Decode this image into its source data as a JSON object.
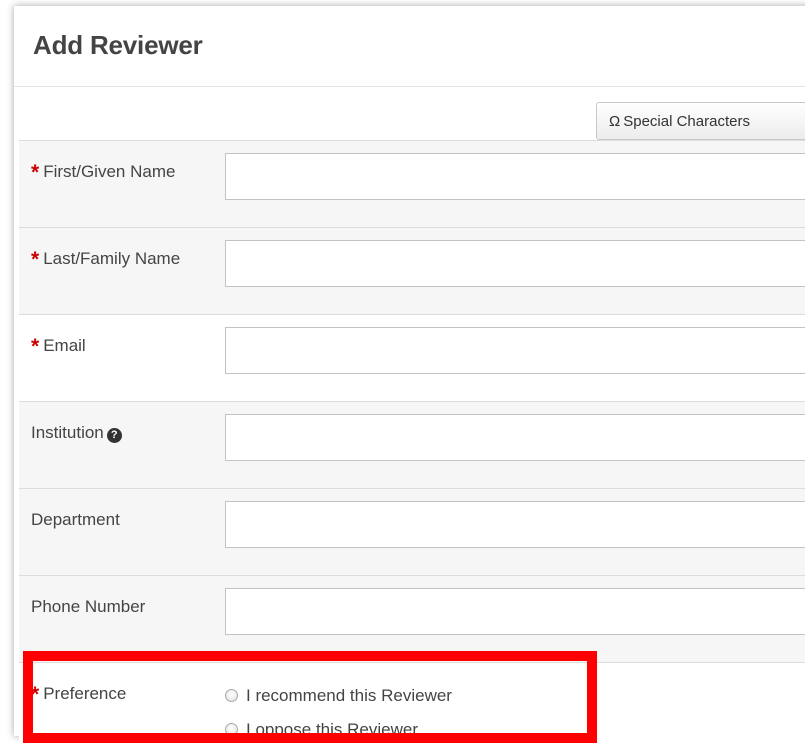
{
  "dialog": {
    "title": "Add Reviewer",
    "special_characters_button": {
      "symbol": "Ω",
      "label": "Special Characters"
    }
  },
  "fields": {
    "first_name": {
      "label": "First/Given Name",
      "required_marker": "*",
      "value": ""
    },
    "last_name": {
      "label": "Last/Family Name",
      "required_marker": "*",
      "value": ""
    },
    "email": {
      "label": "Email",
      "required_marker": "*",
      "value": ""
    },
    "institution": {
      "label": "Institution",
      "help_icon_symbol": "?",
      "value": ""
    },
    "department": {
      "label": "Department",
      "value": ""
    },
    "phone": {
      "label": "Phone Number",
      "value": ""
    }
  },
  "preference": {
    "label": "Preference",
    "required_marker": "*",
    "options": [
      {
        "label": "I recommend this Reviewer",
        "selected": false
      },
      {
        "label": "I oppose this Reviewer",
        "selected": false
      }
    ]
  },
  "colors": {
    "required": "#cc0000",
    "highlight": "#ff0000",
    "row_alt": "#f6f6f6"
  }
}
